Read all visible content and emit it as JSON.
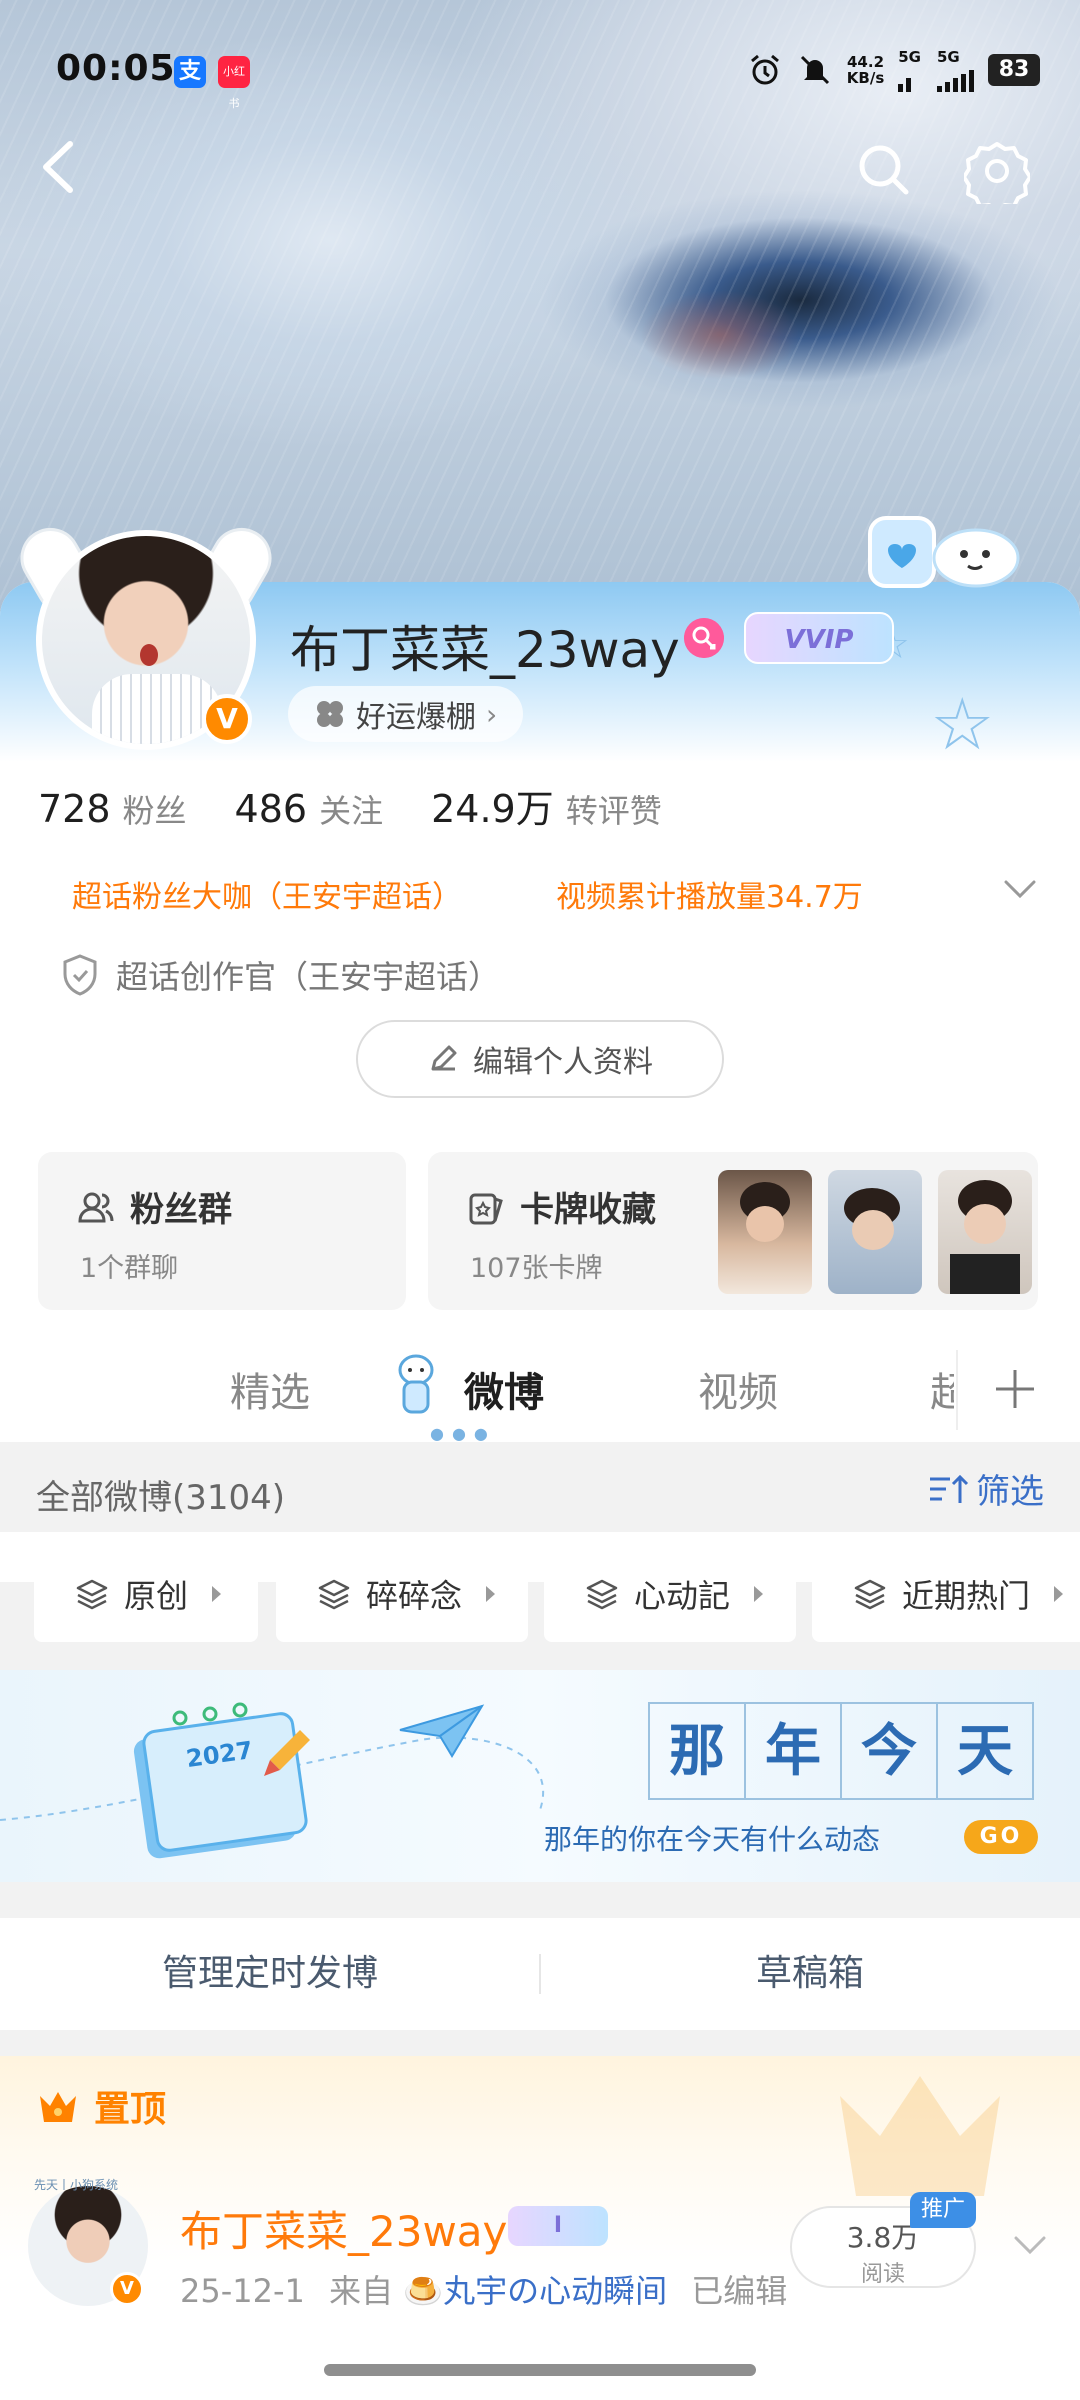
{
  "status_bar": {
    "time": "00:05",
    "app_icon_1": "支",
    "app_icon_2": "小红书",
    "net_speed_value": "44.2",
    "net_speed_unit": "KB/s",
    "sim1_label": "5G",
    "sim2_label": "5G",
    "battery": "83",
    "icons": [
      "alarm-icon",
      "mute-icon"
    ]
  },
  "nav": {
    "back_icon": "chevron-left-icon",
    "search_icon": "search-icon",
    "settings_icon": "gear-icon"
  },
  "profile": {
    "username": "布丁菜菜_23way",
    "vip_badge": "VVIP",
    "verified_mark": "V",
    "luck_label": "好运爆棚",
    "stats": [
      {
        "value": "728",
        "label": "粉丝"
      },
      {
        "value": "486",
        "label": "关注"
      },
      {
        "value": "24.9万",
        "label": "转评赞"
      }
    ],
    "badge_supertopic": "超话粉丝大咖（王安宇超话）",
    "badge_views": "视频累计播放量34.7万",
    "creator_title": "超话创作官（王安宇超话）",
    "edit_button": "编辑个人资料"
  },
  "cards": {
    "fans": {
      "title": "粉丝群",
      "subtitle": "1个群聊"
    },
    "collection": {
      "title": "卡牌收藏",
      "subtitle": "107张卡牌"
    }
  },
  "tabs": {
    "items": [
      {
        "label": "精选",
        "active": false
      },
      {
        "label": "微博",
        "active": true
      },
      {
        "label": "视频",
        "active": false
      },
      {
        "label": "超",
        "active": false
      }
    ],
    "add_icon": "plus-icon"
  },
  "feed": {
    "all_label": "全部微博(3104)",
    "filter_label": "筛选",
    "chips": [
      "原创",
      "碎碎念",
      "心动記",
      "近期热门"
    ],
    "banner": {
      "chars": [
        "那",
        "年",
        "今",
        "天"
      ],
      "subtitle": "那年的你在今天有什么动态",
      "go": "GO",
      "calendar_year": "2027"
    },
    "manage_label": "管理定时发博",
    "drafts_label": "草稿箱"
  },
  "pinned_post": {
    "pin_label": "置顶",
    "avatar_tag": "先天丨小狗系统",
    "username": "布丁菜菜_23way",
    "vip_badge": "I",
    "date": "25-12-1",
    "from_prefix": "来自",
    "source": "🍮丸宇の心动瞬间",
    "edited": "已编辑",
    "read_count": "3.8万",
    "read_label": "阅读",
    "promo_label": "推广"
  },
  "colors": {
    "accent_orange": "#ff7a0a",
    "link_blue": "#3a6fc8",
    "vip_purple": "#7c6fd8",
    "verified_orange": "#ff8a00"
  }
}
